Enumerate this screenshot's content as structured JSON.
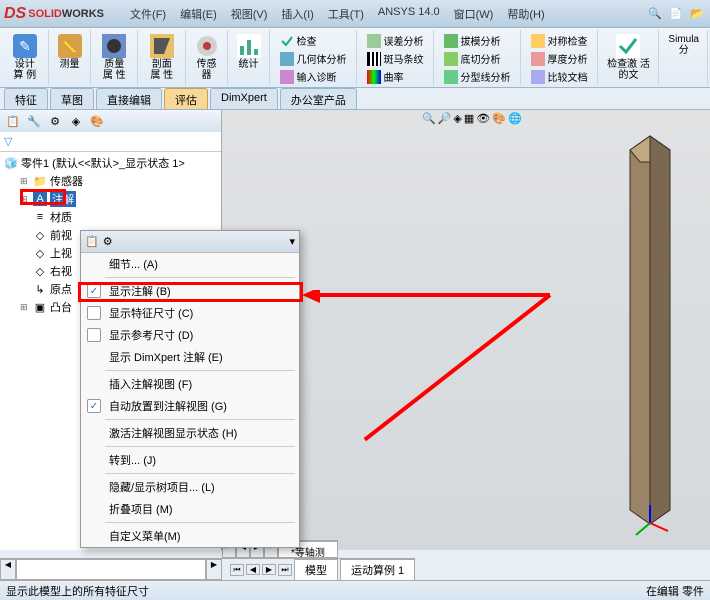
{
  "title_bar": {
    "logo_solid": "SOLID",
    "logo_works": "WORKS"
  },
  "menu": {
    "file": "文件(F)",
    "edit": "编辑(E)",
    "view": "视图(V)",
    "insert": "插入(I)",
    "tools": "工具(T)",
    "ansys": "ANSYS 14.0",
    "window": "窗口(W)",
    "help": "帮助(H)"
  },
  "ribbon": {
    "design_study": "设计算\n例",
    "measure": "测量",
    "mass_props": "质量属\n性",
    "section_props": "剖面属\n性",
    "sensor": "传感器",
    "stats": "统计",
    "check": "检查",
    "geometry_analysis": "几何体分析",
    "input_diag": "输入诊断",
    "error_diag": "误差分析",
    "zebra": "斑马条纹",
    "curvature": "曲率",
    "draft_analysis": "拔模分析",
    "undercut": "底切分析",
    "partline": "分型线分析",
    "symmetry_check": "对称检查",
    "thickness": "厚度分析",
    "compare_docs": "比较文档",
    "check_active": "检查激\n活的文",
    "simulation": "Simula\n分"
  },
  "tabs": {
    "features": "特征",
    "sketch": "草图",
    "direct_edit": "直接编辑",
    "evaluate": "评估",
    "dimxpert": "DimXpert",
    "office": "办公室产品"
  },
  "tree": {
    "root": "零件1 (默认<<默认>_显示状态 1>",
    "sensors": "传感器",
    "annotations": "注解",
    "material": "材质",
    "front_plane": "前视",
    "top_plane": "上视",
    "right_plane": "右视",
    "origin": "原点",
    "extrude": "凸台"
  },
  "context_menu": {
    "details": "细节... (A)",
    "show_annotations": "显示注解 (B)",
    "show_feature_dims": "显示特征尺寸 (C)",
    "show_ref_dims": "显示参考尺寸 (D)",
    "show_dimxpert": "显示 DimXpert 注解 (E)",
    "insert_ann_view": "插入注解视图 (F)",
    "auto_place_ann": "自动放置到注解视图 (G)",
    "activate_ann_state": "激活注解视图显示状态 (H)",
    "goto": "转到... (J)",
    "hide_show_tree": "隐藏/显示树项目... (L)",
    "collapse_items": "折叠项目 (M)",
    "customize_menu": "自定义菜单(M)"
  },
  "viewport_tabs": {
    "isometric": "*等轴测"
  },
  "bottom_tabs": {
    "model": "模型",
    "motion_study": "运动算例 1"
  },
  "status": {
    "left": "显示此模型上的所有特征尺寸",
    "right": "在编辑 零件"
  }
}
